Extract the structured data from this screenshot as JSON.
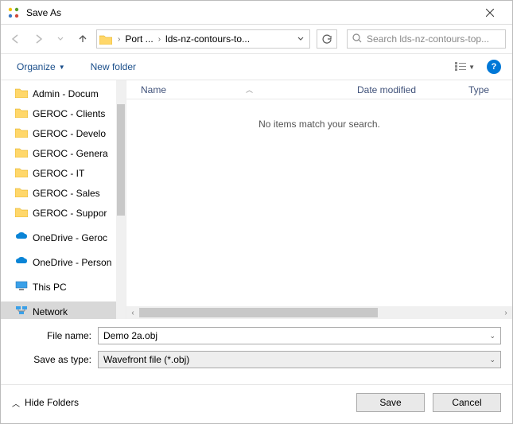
{
  "window": {
    "title": "Save As"
  },
  "nav": {
    "breadcrumb": {
      "seg1": "Port ...",
      "seg2": "lds-nz-contours-to..."
    },
    "search_placeholder": "Search lds-nz-contours-top..."
  },
  "toolbar": {
    "organize": "Organize",
    "newfolder": "New folder"
  },
  "tree": {
    "items": [
      {
        "label": "Admin - Docum",
        "type": "folder"
      },
      {
        "label": "GEROC - Clients",
        "type": "folder"
      },
      {
        "label": "GEROC - Develo",
        "type": "folder"
      },
      {
        "label": "GEROC - Genera",
        "type": "folder"
      },
      {
        "label": "GEROC - IT",
        "type": "folder"
      },
      {
        "label": "GEROC - Sales",
        "type": "folder"
      },
      {
        "label": "GEROC - Suppor",
        "type": "folder"
      },
      {
        "label": "OneDrive - Geroc",
        "type": "onedrive"
      },
      {
        "label": "OneDrive - Person",
        "type": "onedrive"
      },
      {
        "label": "This PC",
        "type": "pc"
      },
      {
        "label": "Network",
        "type": "network"
      }
    ]
  },
  "list": {
    "cols": {
      "name": "Name",
      "date": "Date modified",
      "type": "Type"
    },
    "empty": "No items match your search."
  },
  "form": {
    "filename_label": "File name:",
    "filename_value": "Demo 2a.obj",
    "type_label": "Save as type:",
    "type_value": "Wavefront file (*.obj)"
  },
  "footer": {
    "hide": "Hide Folders",
    "save": "Save",
    "cancel": "Cancel"
  }
}
